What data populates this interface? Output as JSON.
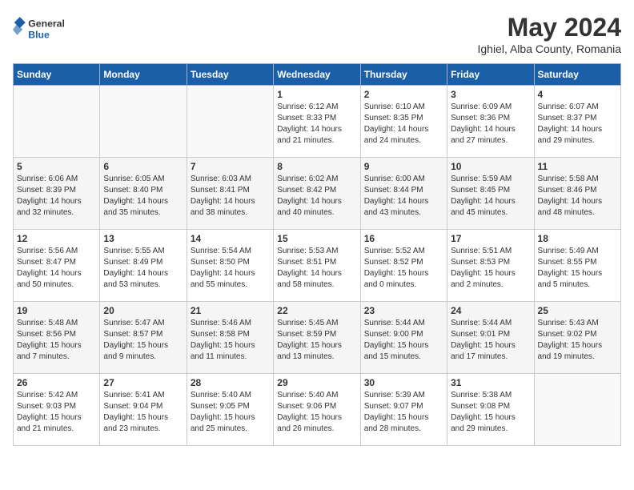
{
  "header": {
    "logo_general": "General",
    "logo_blue": "Blue",
    "month_year": "May 2024",
    "location": "Ighiel, Alba County, Romania"
  },
  "days_of_week": [
    "Sunday",
    "Monday",
    "Tuesday",
    "Wednesday",
    "Thursday",
    "Friday",
    "Saturday"
  ],
  "weeks": [
    [
      {
        "day": "",
        "info": ""
      },
      {
        "day": "",
        "info": ""
      },
      {
        "day": "",
        "info": ""
      },
      {
        "day": "1",
        "info": "Sunrise: 6:12 AM\nSunset: 8:33 PM\nDaylight: 14 hours\nand 21 minutes."
      },
      {
        "day": "2",
        "info": "Sunrise: 6:10 AM\nSunset: 8:35 PM\nDaylight: 14 hours\nand 24 minutes."
      },
      {
        "day": "3",
        "info": "Sunrise: 6:09 AM\nSunset: 8:36 PM\nDaylight: 14 hours\nand 27 minutes."
      },
      {
        "day": "4",
        "info": "Sunrise: 6:07 AM\nSunset: 8:37 PM\nDaylight: 14 hours\nand 29 minutes."
      }
    ],
    [
      {
        "day": "5",
        "info": "Sunrise: 6:06 AM\nSunset: 8:39 PM\nDaylight: 14 hours\nand 32 minutes."
      },
      {
        "day": "6",
        "info": "Sunrise: 6:05 AM\nSunset: 8:40 PM\nDaylight: 14 hours\nand 35 minutes."
      },
      {
        "day": "7",
        "info": "Sunrise: 6:03 AM\nSunset: 8:41 PM\nDaylight: 14 hours\nand 38 minutes."
      },
      {
        "day": "8",
        "info": "Sunrise: 6:02 AM\nSunset: 8:42 PM\nDaylight: 14 hours\nand 40 minutes."
      },
      {
        "day": "9",
        "info": "Sunrise: 6:00 AM\nSunset: 8:44 PM\nDaylight: 14 hours\nand 43 minutes."
      },
      {
        "day": "10",
        "info": "Sunrise: 5:59 AM\nSunset: 8:45 PM\nDaylight: 14 hours\nand 45 minutes."
      },
      {
        "day": "11",
        "info": "Sunrise: 5:58 AM\nSunset: 8:46 PM\nDaylight: 14 hours\nand 48 minutes."
      }
    ],
    [
      {
        "day": "12",
        "info": "Sunrise: 5:56 AM\nSunset: 8:47 PM\nDaylight: 14 hours\nand 50 minutes."
      },
      {
        "day": "13",
        "info": "Sunrise: 5:55 AM\nSunset: 8:49 PM\nDaylight: 14 hours\nand 53 minutes."
      },
      {
        "day": "14",
        "info": "Sunrise: 5:54 AM\nSunset: 8:50 PM\nDaylight: 14 hours\nand 55 minutes."
      },
      {
        "day": "15",
        "info": "Sunrise: 5:53 AM\nSunset: 8:51 PM\nDaylight: 14 hours\nand 58 minutes."
      },
      {
        "day": "16",
        "info": "Sunrise: 5:52 AM\nSunset: 8:52 PM\nDaylight: 15 hours\nand 0 minutes."
      },
      {
        "day": "17",
        "info": "Sunrise: 5:51 AM\nSunset: 8:53 PM\nDaylight: 15 hours\nand 2 minutes."
      },
      {
        "day": "18",
        "info": "Sunrise: 5:49 AM\nSunset: 8:55 PM\nDaylight: 15 hours\nand 5 minutes."
      }
    ],
    [
      {
        "day": "19",
        "info": "Sunrise: 5:48 AM\nSunset: 8:56 PM\nDaylight: 15 hours\nand 7 minutes."
      },
      {
        "day": "20",
        "info": "Sunrise: 5:47 AM\nSunset: 8:57 PM\nDaylight: 15 hours\nand 9 minutes."
      },
      {
        "day": "21",
        "info": "Sunrise: 5:46 AM\nSunset: 8:58 PM\nDaylight: 15 hours\nand 11 minutes."
      },
      {
        "day": "22",
        "info": "Sunrise: 5:45 AM\nSunset: 8:59 PM\nDaylight: 15 hours\nand 13 minutes."
      },
      {
        "day": "23",
        "info": "Sunrise: 5:44 AM\nSunset: 9:00 PM\nDaylight: 15 hours\nand 15 minutes."
      },
      {
        "day": "24",
        "info": "Sunrise: 5:44 AM\nSunset: 9:01 PM\nDaylight: 15 hours\nand 17 minutes."
      },
      {
        "day": "25",
        "info": "Sunrise: 5:43 AM\nSunset: 9:02 PM\nDaylight: 15 hours\nand 19 minutes."
      }
    ],
    [
      {
        "day": "26",
        "info": "Sunrise: 5:42 AM\nSunset: 9:03 PM\nDaylight: 15 hours\nand 21 minutes."
      },
      {
        "day": "27",
        "info": "Sunrise: 5:41 AM\nSunset: 9:04 PM\nDaylight: 15 hours\nand 23 minutes."
      },
      {
        "day": "28",
        "info": "Sunrise: 5:40 AM\nSunset: 9:05 PM\nDaylight: 15 hours\nand 25 minutes."
      },
      {
        "day": "29",
        "info": "Sunrise: 5:40 AM\nSunset: 9:06 PM\nDaylight: 15 hours\nand 26 minutes."
      },
      {
        "day": "30",
        "info": "Sunrise: 5:39 AM\nSunset: 9:07 PM\nDaylight: 15 hours\nand 28 minutes."
      },
      {
        "day": "31",
        "info": "Sunrise: 5:38 AM\nSunset: 9:08 PM\nDaylight: 15 hours\nand 29 minutes."
      },
      {
        "day": "",
        "info": ""
      }
    ]
  ]
}
